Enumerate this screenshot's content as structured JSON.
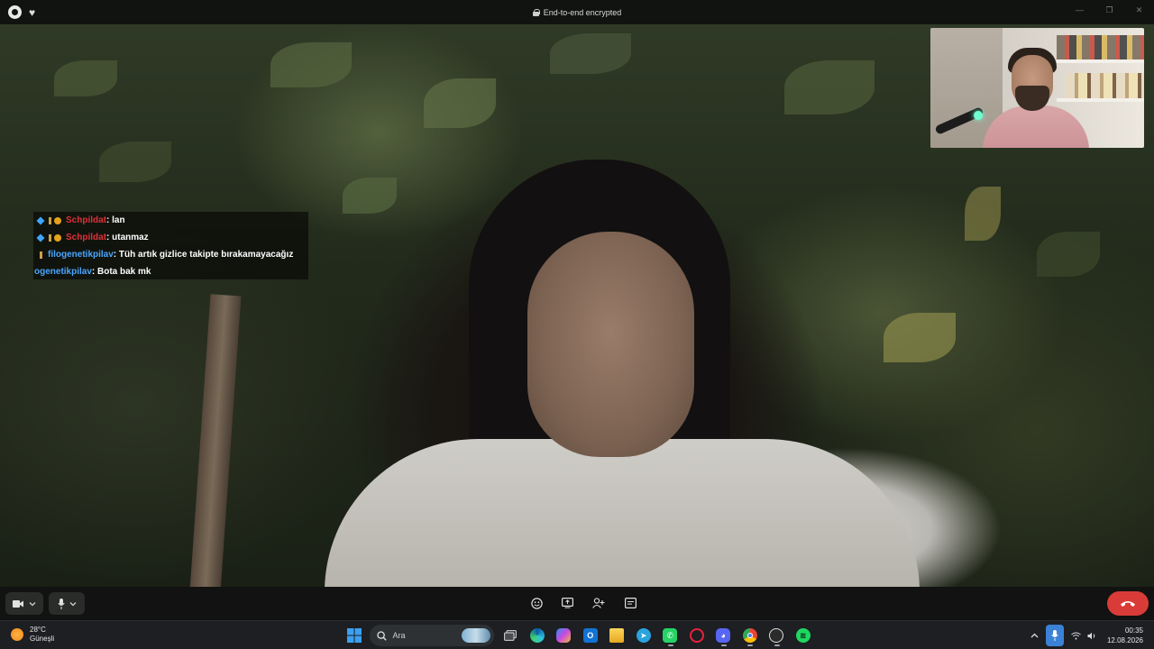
{
  "titlebar": {
    "app_icon": "whatsapp-icon",
    "favorite_icon": "heart-icon",
    "encryption_text": "End-to-end encrypted",
    "window_controls": [
      "minimize",
      "restore",
      "close"
    ]
  },
  "chat_overlay": {
    "lines": [
      {
        "user": "Schpildat",
        "message": ": lan",
        "user_color": "#e0303a",
        "badges": [
          "cube",
          "sword",
          "coin"
        ]
      },
      {
        "user": "Schpildat",
        "message": ": utanmaz",
        "user_color": "#e0303a",
        "badges": [
          "cube",
          "sword",
          "coin"
        ]
      },
      {
        "user": "filogenetikpilav",
        "message": ": Tüh artık gizlice takipte bırakamayacağız",
        "user_color": "#4aa6ff",
        "badges": [
          "sword"
        ]
      },
      {
        "user": "ogenetikpilav",
        "message": ": Bota bak mk",
        "user_color": "#4aa6ff",
        "badges": []
      }
    ]
  },
  "call_controls": {
    "left": [
      "video-camera-icon",
      "chevron-down-icon",
      "microphone-icon",
      "chevron-down-icon"
    ],
    "center": [
      "emoji-icon",
      "screen-share-icon",
      "add-person-icon",
      "more-options-icon"
    ],
    "end_call": "end-call-icon",
    "end_call_color": "#d93c38"
  },
  "taskbar": {
    "weather": {
      "temperature": "28°C",
      "condition": "Güneşli"
    },
    "search_placeholder": "Ara",
    "apps": [
      "windows-start",
      "search",
      "task-view",
      "edge",
      "copilot",
      "outlook",
      "file-explorer",
      "telegram",
      "whatsapp",
      "opera-gx",
      "discord",
      "chrome",
      "obs",
      "spotify"
    ],
    "clock": {
      "time": "00:35",
      "date": "12.08.2026"
    }
  }
}
